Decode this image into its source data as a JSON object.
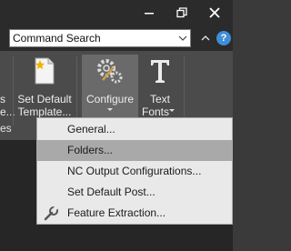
{
  "window": {
    "minimize_icon": "minimize-icon",
    "restore_icon": "restore-icon",
    "close_icon": "close-icon"
  },
  "search": {
    "value": "Command Search",
    "dropdown_icon": "chevron-down-icon",
    "help_icon": "help-icon",
    "help_glyph": "?",
    "collapse_icon": "chevron-up-icon"
  },
  "ribbon": {
    "partial_left": {
      "line1": "s",
      "line2": "e...",
      "group_label": "es"
    },
    "set_default_template": {
      "line1": "Set Default",
      "line2": "Template...",
      "icon": "document-star-icon"
    },
    "configure": {
      "label": "Configure",
      "icon": "gears-icon",
      "dropdown_icon": "chevron-down-icon"
    },
    "text_fonts": {
      "line1": "Text",
      "line2": "Fonts",
      "icon": "text-t-icon",
      "dropdown_icon": "chevron-down-icon"
    }
  },
  "menu": {
    "items": [
      {
        "label": "General...",
        "highlighted": false
      },
      {
        "label": "Folders...",
        "highlighted": true
      },
      {
        "label": "NC Output Configurations...",
        "highlighted": false
      },
      {
        "label": "Set Default Post...",
        "highlighted": false
      },
      {
        "label": "Feature Extraction...",
        "highlighted": false,
        "icon": "wrench-icon"
      }
    ]
  },
  "colors": {
    "titlebar": "#2b2b2b",
    "ribbon": "#4b4b4b",
    "menu_bg": "#e9e9e9",
    "menu_highlight": "#a9a9a9",
    "help_blue": "#3f8ed8"
  }
}
